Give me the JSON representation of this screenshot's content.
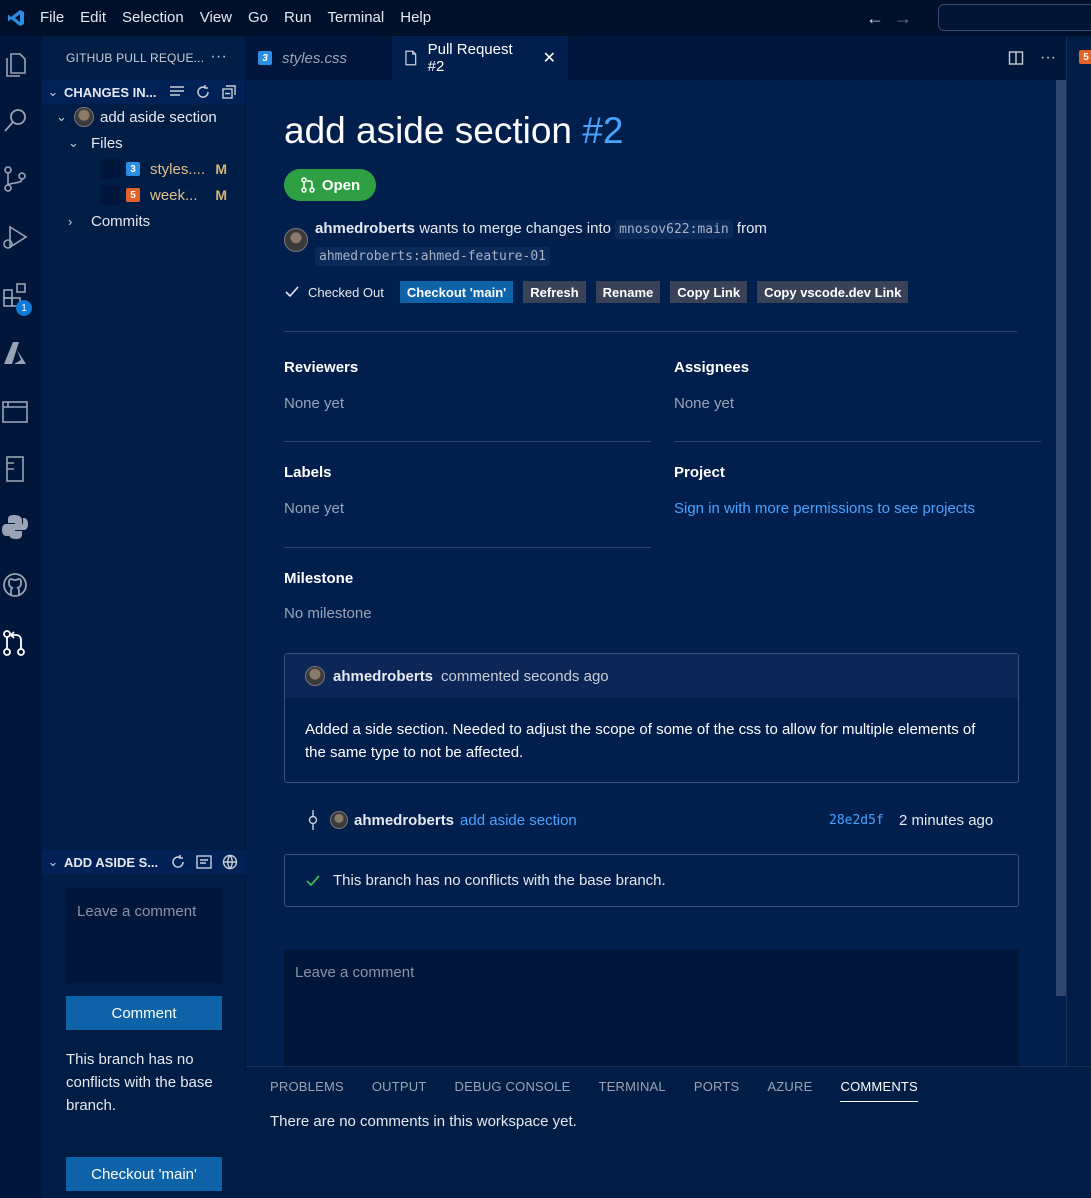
{
  "menubar": {
    "items": [
      "File",
      "Edit",
      "Selection",
      "View",
      "Go",
      "Run",
      "Terminal",
      "Help"
    ]
  },
  "activity": {
    "icons": [
      "files-icon",
      "search-icon",
      "source-control-icon",
      "run-debug-icon",
      "extensions-icon",
      "azure-icon",
      "remote-explorer-icon",
      "notebook-icon",
      "python-icon",
      "github-icon",
      "pull-request-icon"
    ],
    "extensions_badge": "1"
  },
  "sidebar": {
    "header": "GITHUB PULL REQUE...",
    "changes_section": "CHANGES IN...",
    "pr_node": "add aside section",
    "files_node": "Files",
    "files": [
      {
        "name": "styles....",
        "status": "M",
        "type": "css"
      },
      {
        "name": "week...",
        "status": "M",
        "type": "html"
      }
    ],
    "commits_node": "Commits",
    "lower_section": "ADD ASIDE S...",
    "comment_placeholder": "Leave a comment",
    "comment_button": "Comment",
    "branch_status": "This branch has no conflicts with the base branch.",
    "checkout_button": "Checkout 'main'"
  },
  "tabs": [
    {
      "label": "styles.css",
      "active": false
    },
    {
      "label": "Pull Request #2",
      "active": true
    }
  ],
  "pr": {
    "title": "add aside section",
    "number": "#2",
    "status": "Open",
    "author": "ahmedroberts",
    "merge_text_1": "wants to merge changes into",
    "target_branch": "mnosov622:main",
    "merge_text_2": "from",
    "source_branch": "ahmedroberts:ahmed-feature-01",
    "checked_out": "Checked Out",
    "buttons": {
      "checkout": "Checkout 'main'",
      "refresh": "Refresh",
      "rename": "Rename",
      "copy_link": "Copy Link",
      "copy_vscode": "Copy vscode.dev Link"
    },
    "reviewers_label": "Reviewers",
    "reviewers_value": "None yet",
    "assignees_label": "Assignees",
    "assignees_value": "None yet",
    "labels_label": "Labels",
    "labels_value": "None yet",
    "project_label": "Project",
    "project_value": "Sign in with more permissions to see projects",
    "milestone_label": "Milestone",
    "milestone_value": "No milestone",
    "comment": {
      "author": "ahmedroberts",
      "meta": "commented seconds ago",
      "body": "Added a side section. Needed to adjust the scope of some of the css to allow for multiple elements of the same type to not be affected."
    },
    "commit": {
      "author": "ahmedroberts",
      "message": "add aside section",
      "hash": "28e2d5f",
      "time": "2 minutes ago"
    },
    "merge_status": "This branch has no conflicts with the base branch.",
    "comment_placeholder": "Leave a comment"
  },
  "panel": {
    "tabs": [
      "PROBLEMS",
      "OUTPUT",
      "DEBUG CONSOLE",
      "TERMINAL",
      "PORTS",
      "AZURE",
      "COMMENTS"
    ],
    "active_tab": "COMMENTS",
    "message": "There are no comments in this workspace yet."
  },
  "colors": {
    "background": "#001f4d",
    "accent": "#4aa3ff",
    "primary_button": "#0e63a8",
    "open_status": "#2ea043"
  }
}
